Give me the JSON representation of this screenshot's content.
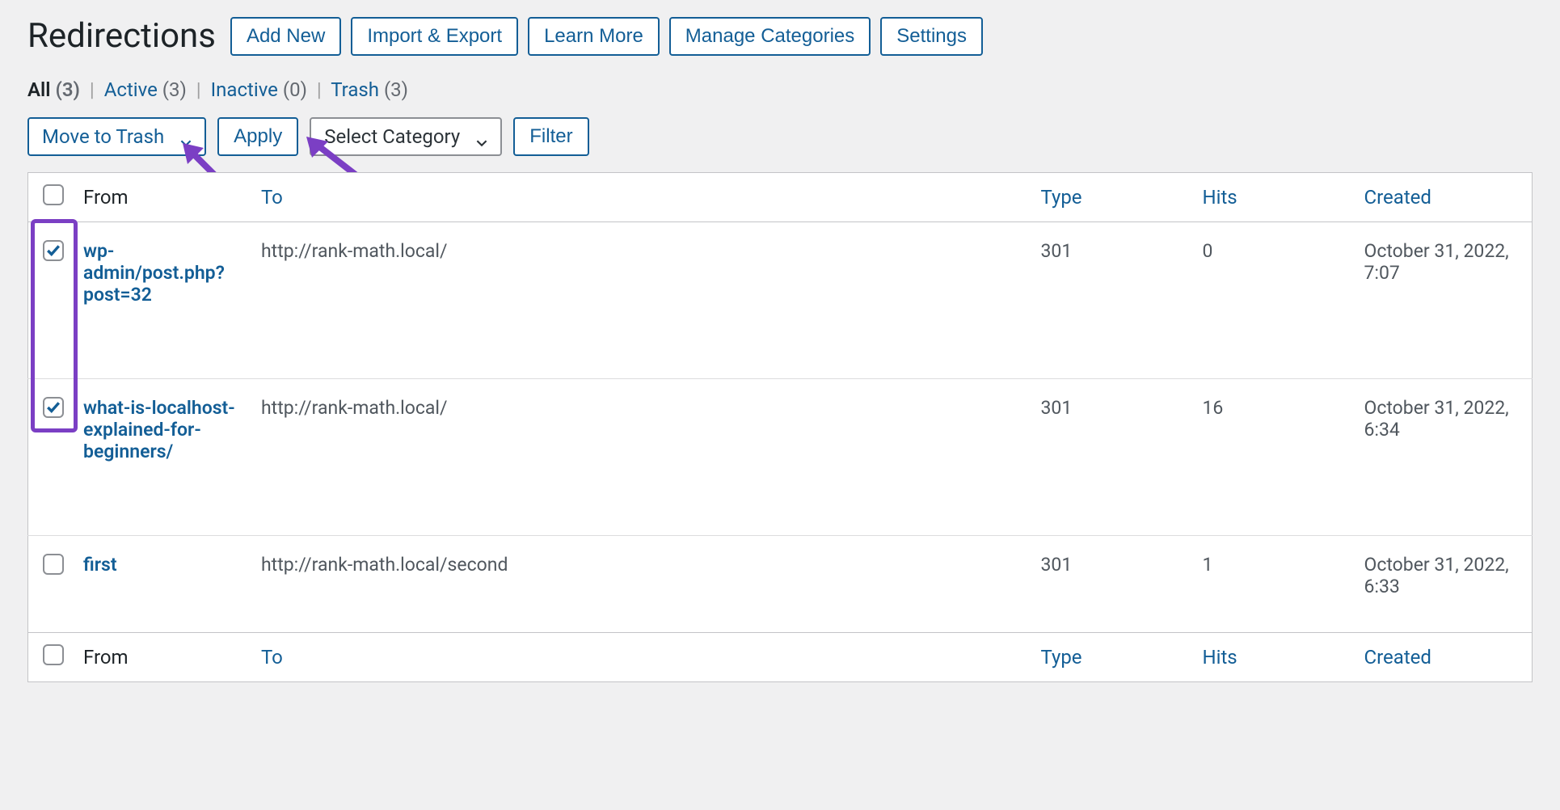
{
  "page": {
    "title": "Redirections"
  },
  "header_buttons": {
    "add_new": "Add New",
    "import_export": "Import & Export",
    "learn_more": "Learn More",
    "manage_categories": "Manage Categories",
    "settings": "Settings"
  },
  "filters": {
    "all_label": "All",
    "all_count": "(3)",
    "active_label": "Active",
    "active_count": "(3)",
    "inactive_label": "Inactive",
    "inactive_count": "(0)",
    "trash_label": "Trash",
    "trash_count": "(3)"
  },
  "actions": {
    "bulk_action": "Move to Trash",
    "apply": "Apply",
    "select_category": "Select Category",
    "filter": "Filter"
  },
  "columns": {
    "from": "From",
    "to": "To",
    "type": "Type",
    "hits": "Hits",
    "created": "Created"
  },
  "rows": [
    {
      "checked": true,
      "from": "wp-admin/post.php?post=32",
      "to": "http://rank-math.local/",
      "type": "301",
      "hits": "0",
      "created": "October 31, 2022, 7:07"
    },
    {
      "checked": true,
      "from": "what-is-localhost-explained-for-beginners/",
      "to": "http://rank-math.local/",
      "type": "301",
      "hits": "16",
      "created": "October 31, 2022, 6:34"
    },
    {
      "checked": false,
      "from": "first",
      "to": "http://rank-math.local/second",
      "type": "301",
      "hits": "1",
      "created": "October 31, 2022, 6:33"
    }
  ]
}
